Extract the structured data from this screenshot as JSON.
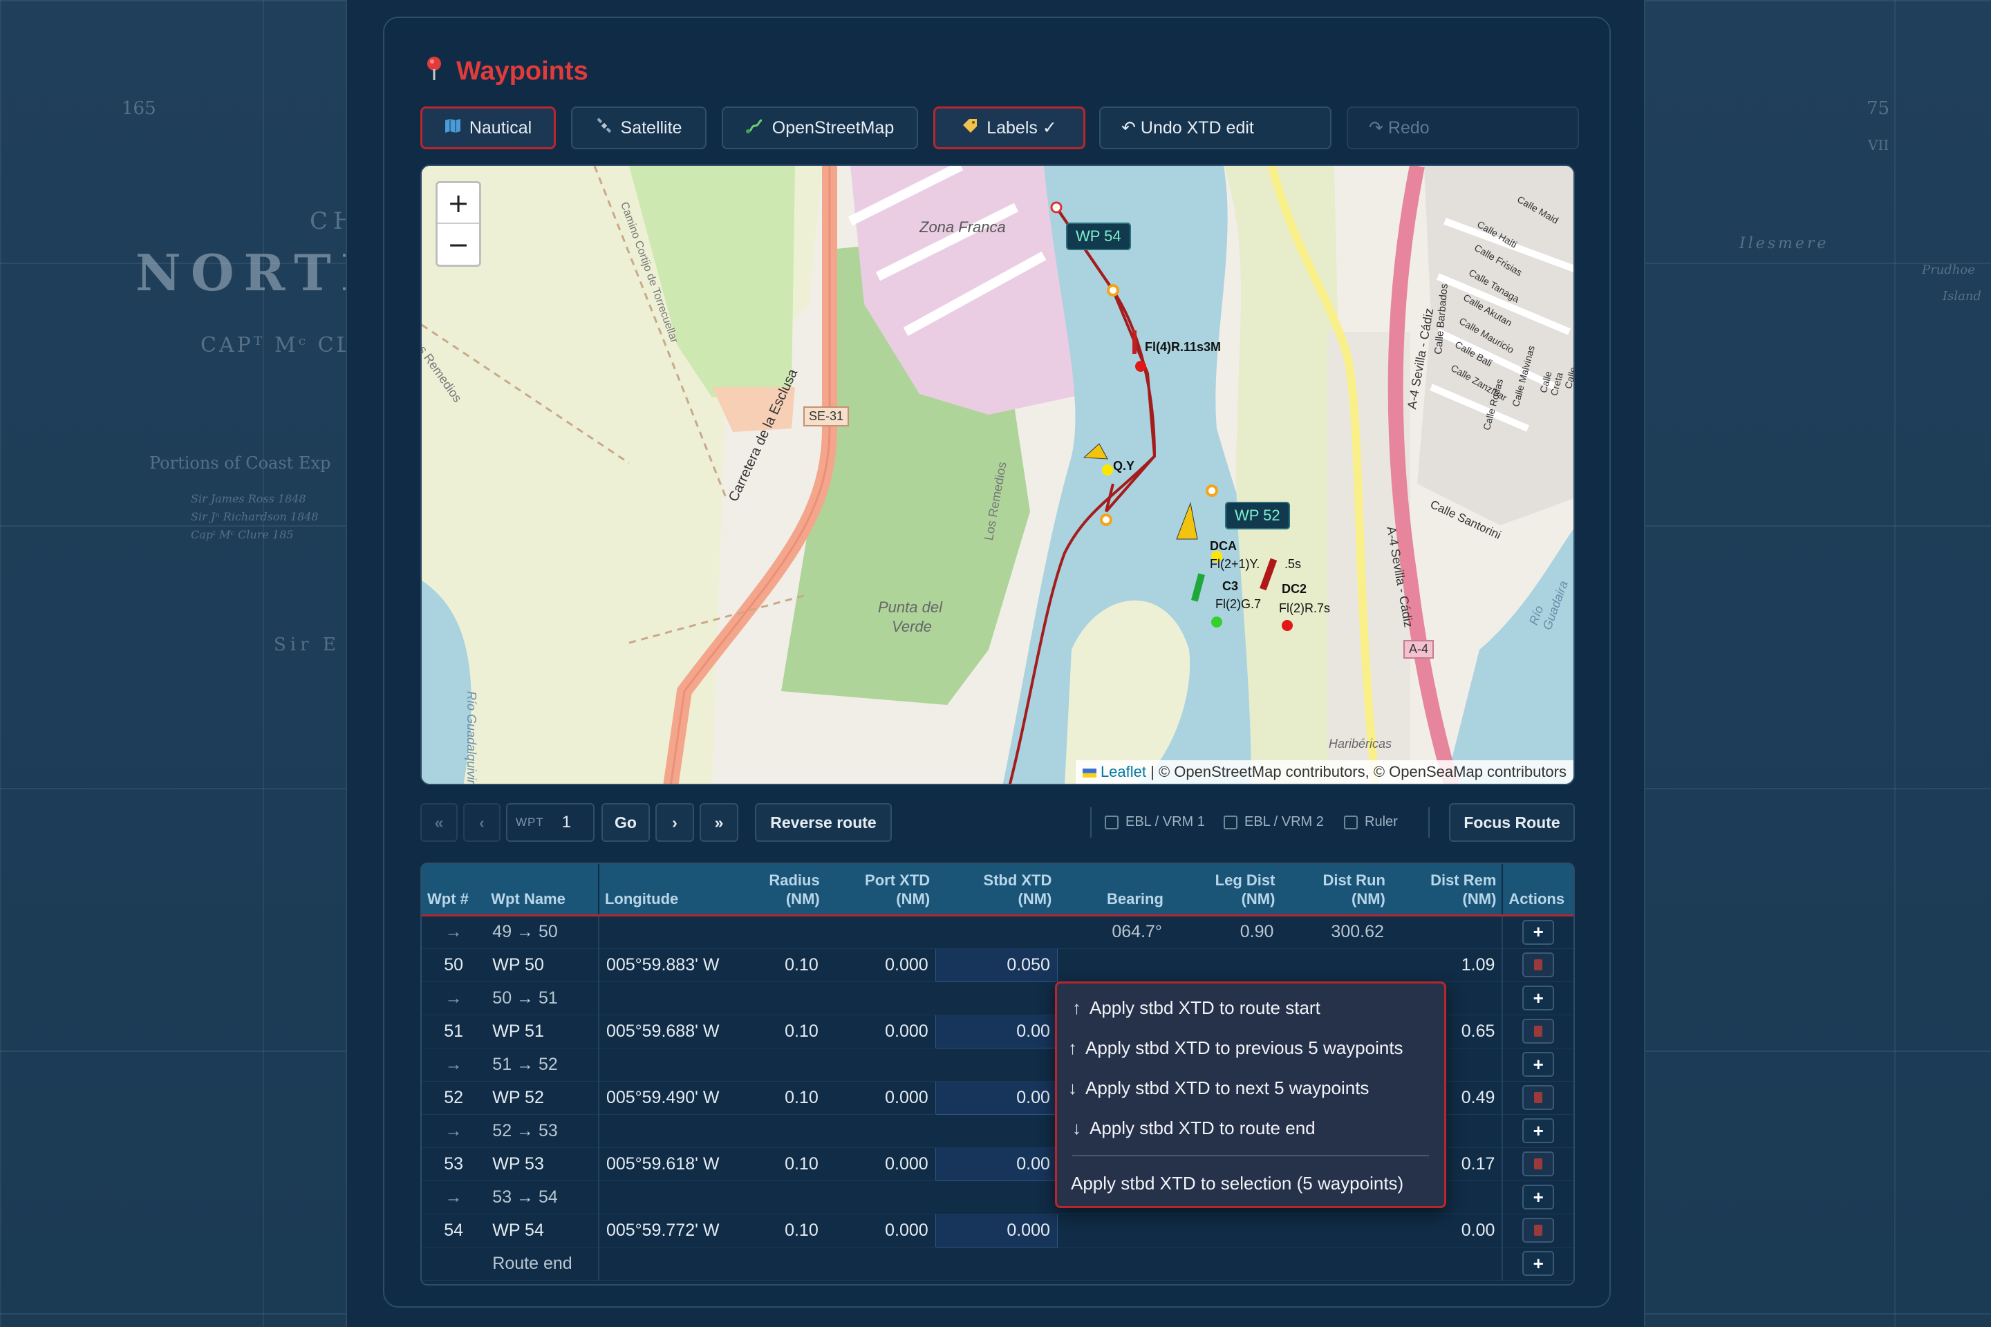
{
  "background": {
    "left_chart_texts": [
      "165",
      "CHA",
      "NORTH-W",
      "CAPᵀ Mᶜ CLU",
      "Portions of Coast Exp",
      "Sir James Ross 1848",
      "Sir Jⁿ Richardson 1848",
      "Capᵗ Mᶜ Clure 185",
      "Sir E"
    ],
    "right_chart_texts": [
      "75",
      "VII",
      "Prudhoe",
      "Island",
      "Ilesmere",
      "Island"
    ]
  },
  "panel": {
    "title": "Waypoints",
    "title_icon": "pin-icon",
    "accent": "#e23b3b"
  },
  "toolbar": {
    "nautical": {
      "label": "Nautical",
      "icon": "map-icon"
    },
    "satellite": {
      "label": "Satellite",
      "icon": "satellite-icon"
    },
    "osm": {
      "label": "OpenStreetMap",
      "icon": "route-icon"
    },
    "labels": {
      "label": "Labels ✓",
      "icon": "tag-icon"
    },
    "undo": {
      "label": "↶ Undo XTD edit"
    },
    "redo": {
      "label": "↷ Redo"
    }
  },
  "map": {
    "zoom_in": "+",
    "zoom_out": "−",
    "attribution_leaflet": "Leaflet",
    "attribution_rest": " | © OpenStreetMap contributors, © OpenSeaMap contributors",
    "waypoint_labels": {
      "wp54": "WP 54",
      "wp52": "WP 52"
    },
    "place_labels": {
      "zona_franca": "Zona Franca",
      "punta_del": "Punta del",
      "verde": "Verde",
      "se31": "SE-31",
      "carretera": "Carretera de la Esclusa",
      "remedios": "Los Remedios",
      "remedios2": "Los Remedios",
      "camino": "Camino Cortijo de Torrecuellar",
      "rio_guad_left": "Río Guadalquivir",
      "rio_guad_right": "Río Guadaira",
      "a4_1": "A-4 Sevilla - Cádiz",
      "a4_2": "A-4 Sevilla - Cádiz",
      "a4_badge": "A-4",
      "haribericas": "Haribéricas",
      "calle_santorini": "Calle Santorini",
      "calle_barbados": "Calle Barbados",
      "calles": [
        "Calle Maid",
        "Calle Haiti",
        "Calle Frisias",
        "Calle Tanaga",
        "Calle Akutan",
        "Calle Mauricio",
        "Calle Bali",
        "Calle Zanzíbar",
        "Calle Rodas",
        "Calle Malvinas",
        "Calle Creta",
        "Calle Santo"
      ]
    },
    "marks": {
      "fl4r": "Fl(4)R.11s3M",
      "qy": "Q.Y",
      "dca": "DCA",
      "dca_light": "Fl(2+1)Y.",
      "dc2_period": ".5s",
      "c3": "C3",
      "c3_light": "Fl(2)G.7",
      "dc2": "DC2",
      "dc2_light": "Fl(2)R.7s"
    }
  },
  "nav": {
    "first": "«",
    "prev": "‹",
    "wpt_label": "WPT",
    "wpt_value": "1",
    "go": "Go",
    "next": "›",
    "last": "»",
    "reverse": "Reverse route",
    "ebl1": "EBL / VRM 1",
    "ebl2": "EBL / VRM 2",
    "ruler": "Ruler",
    "focus": "Focus Route"
  },
  "table": {
    "headers": {
      "wpt_num": "Wpt #",
      "wpt_name": "Wpt Name",
      "longitude": "Longitude",
      "radius": [
        "Radius",
        "(NM)"
      ],
      "port_xtd": [
        "Port XTD",
        "(NM)"
      ],
      "stbd_xtd": [
        "Stbd XTD",
        "(NM)"
      ],
      "bearing": "Bearing",
      "leg_dist": [
        "Leg Dist",
        "(NM)"
      ],
      "dist_run": [
        "Dist Run",
        "(NM)"
      ],
      "dist_rem": [
        "Dist Rem",
        "(NM)"
      ],
      "actions": "Actions"
    },
    "rows": [
      {
        "type": "leg",
        "arrow": "→",
        "name": "49 → 50",
        "bearing": "064.7°",
        "leg": "0.90",
        "run": "300.62"
      },
      {
        "type": "wpt",
        "num": "50",
        "name": "WP 50",
        "lon": "005°59.883' W",
        "radius": "0.10",
        "port": "0.000",
        "stbd": "0.050",
        "rem": "1.09"
      },
      {
        "type": "leg",
        "arrow": "→",
        "name": "50 → 51",
        "bearing": "",
        "leg": "",
        "run": ""
      },
      {
        "type": "wpt",
        "num": "51",
        "name": "WP 51",
        "lon": "005°59.688' W",
        "radius": "0.10",
        "port": "0.000",
        "stbd": "0.00",
        "rem": "0.65"
      },
      {
        "type": "leg",
        "arrow": "→",
        "name": "51 → 52",
        "bearing": "",
        "leg": "",
        "run": ""
      },
      {
        "type": "wpt",
        "num": "52",
        "name": "WP 52",
        "lon": "005°59.490' W",
        "radius": "0.10",
        "port": "0.000",
        "stbd": "0.00",
        "rem": "0.49"
      },
      {
        "type": "leg",
        "arrow": "→",
        "name": "52 → 53",
        "bearing": "",
        "leg": "",
        "run": ""
      },
      {
        "type": "wpt",
        "num": "53",
        "name": "WP 53",
        "lon": "005°59.618' W",
        "radius": "0.10",
        "port": "0.000",
        "stbd": "0.00",
        "rem": "0.17"
      },
      {
        "type": "leg",
        "arrow": "→",
        "name": "53 → 54",
        "bearing": "",
        "leg": "",
        "run": ""
      },
      {
        "type": "wpt",
        "num": "54",
        "name": "WP 54",
        "lon": "005°59.772' W",
        "radius": "0.10",
        "port": "0.000",
        "stbd": "0.000",
        "rem": "0.00"
      },
      {
        "type": "end",
        "name": "Route end"
      }
    ],
    "add_icon": "+",
    "delete_icon": "trash-icon"
  },
  "context_menu": {
    "items": [
      {
        "arrow": "↑",
        "label": "Apply stbd XTD to route start"
      },
      {
        "arrow": "↑",
        "label": "Apply stbd XTD to previous 5 waypoints"
      },
      {
        "arrow": "↓",
        "label": "Apply stbd XTD to next 5 waypoints"
      },
      {
        "arrow": "↓",
        "label": "Apply stbd XTD to route end"
      }
    ],
    "selection": "Apply stbd XTD to selection (5 waypoints)"
  },
  "colors": {
    "accent_red": "#b7272c",
    "header_blue": "#1a5578",
    "panel": "#0f2b45",
    "wp_label": "#7ff0d0",
    "route": "#a41c1c"
  }
}
